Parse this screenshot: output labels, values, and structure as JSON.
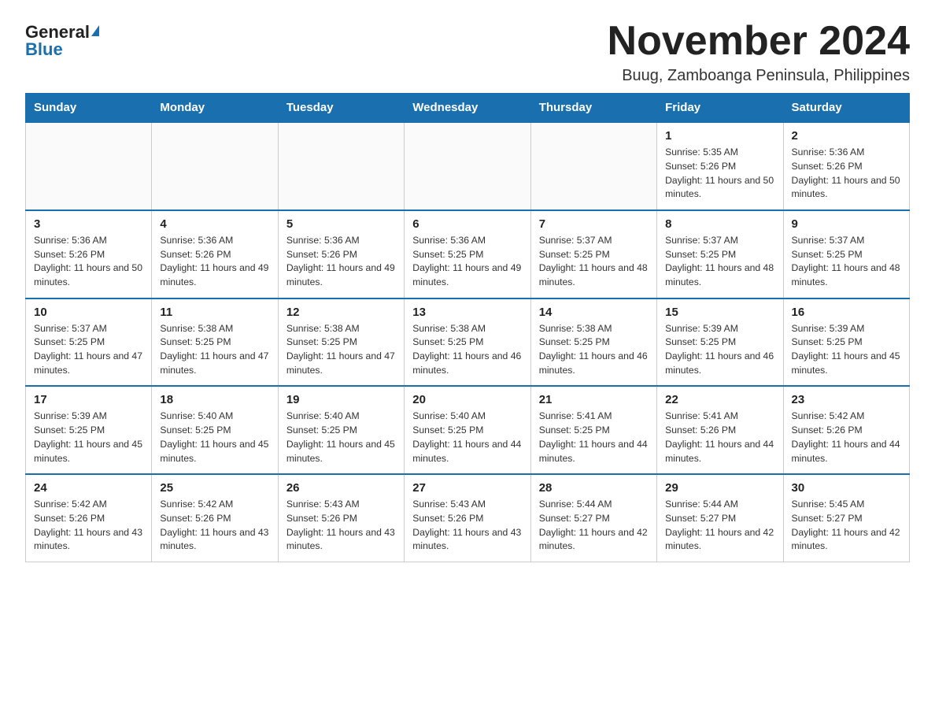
{
  "logo": {
    "general": "General",
    "blue": "Blue"
  },
  "header": {
    "month_year": "November 2024",
    "location": "Buug, Zamboanga Peninsula, Philippines"
  },
  "days_of_week": [
    "Sunday",
    "Monday",
    "Tuesday",
    "Wednesday",
    "Thursday",
    "Friday",
    "Saturday"
  ],
  "weeks": [
    [
      {
        "day": "",
        "info": ""
      },
      {
        "day": "",
        "info": ""
      },
      {
        "day": "",
        "info": ""
      },
      {
        "day": "",
        "info": ""
      },
      {
        "day": "",
        "info": ""
      },
      {
        "day": "1",
        "info": "Sunrise: 5:35 AM\nSunset: 5:26 PM\nDaylight: 11 hours and 50 minutes."
      },
      {
        "day": "2",
        "info": "Sunrise: 5:36 AM\nSunset: 5:26 PM\nDaylight: 11 hours and 50 minutes."
      }
    ],
    [
      {
        "day": "3",
        "info": "Sunrise: 5:36 AM\nSunset: 5:26 PM\nDaylight: 11 hours and 50 minutes."
      },
      {
        "day": "4",
        "info": "Sunrise: 5:36 AM\nSunset: 5:26 PM\nDaylight: 11 hours and 49 minutes."
      },
      {
        "day": "5",
        "info": "Sunrise: 5:36 AM\nSunset: 5:26 PM\nDaylight: 11 hours and 49 minutes."
      },
      {
        "day": "6",
        "info": "Sunrise: 5:36 AM\nSunset: 5:25 PM\nDaylight: 11 hours and 49 minutes."
      },
      {
        "day": "7",
        "info": "Sunrise: 5:37 AM\nSunset: 5:25 PM\nDaylight: 11 hours and 48 minutes."
      },
      {
        "day": "8",
        "info": "Sunrise: 5:37 AM\nSunset: 5:25 PM\nDaylight: 11 hours and 48 minutes."
      },
      {
        "day": "9",
        "info": "Sunrise: 5:37 AM\nSunset: 5:25 PM\nDaylight: 11 hours and 48 minutes."
      }
    ],
    [
      {
        "day": "10",
        "info": "Sunrise: 5:37 AM\nSunset: 5:25 PM\nDaylight: 11 hours and 47 minutes."
      },
      {
        "day": "11",
        "info": "Sunrise: 5:38 AM\nSunset: 5:25 PM\nDaylight: 11 hours and 47 minutes."
      },
      {
        "day": "12",
        "info": "Sunrise: 5:38 AM\nSunset: 5:25 PM\nDaylight: 11 hours and 47 minutes."
      },
      {
        "day": "13",
        "info": "Sunrise: 5:38 AM\nSunset: 5:25 PM\nDaylight: 11 hours and 46 minutes."
      },
      {
        "day": "14",
        "info": "Sunrise: 5:38 AM\nSunset: 5:25 PM\nDaylight: 11 hours and 46 minutes."
      },
      {
        "day": "15",
        "info": "Sunrise: 5:39 AM\nSunset: 5:25 PM\nDaylight: 11 hours and 46 minutes."
      },
      {
        "day": "16",
        "info": "Sunrise: 5:39 AM\nSunset: 5:25 PM\nDaylight: 11 hours and 45 minutes."
      }
    ],
    [
      {
        "day": "17",
        "info": "Sunrise: 5:39 AM\nSunset: 5:25 PM\nDaylight: 11 hours and 45 minutes."
      },
      {
        "day": "18",
        "info": "Sunrise: 5:40 AM\nSunset: 5:25 PM\nDaylight: 11 hours and 45 minutes."
      },
      {
        "day": "19",
        "info": "Sunrise: 5:40 AM\nSunset: 5:25 PM\nDaylight: 11 hours and 45 minutes."
      },
      {
        "day": "20",
        "info": "Sunrise: 5:40 AM\nSunset: 5:25 PM\nDaylight: 11 hours and 44 minutes."
      },
      {
        "day": "21",
        "info": "Sunrise: 5:41 AM\nSunset: 5:25 PM\nDaylight: 11 hours and 44 minutes."
      },
      {
        "day": "22",
        "info": "Sunrise: 5:41 AM\nSunset: 5:26 PM\nDaylight: 11 hours and 44 minutes."
      },
      {
        "day": "23",
        "info": "Sunrise: 5:42 AM\nSunset: 5:26 PM\nDaylight: 11 hours and 44 minutes."
      }
    ],
    [
      {
        "day": "24",
        "info": "Sunrise: 5:42 AM\nSunset: 5:26 PM\nDaylight: 11 hours and 43 minutes."
      },
      {
        "day": "25",
        "info": "Sunrise: 5:42 AM\nSunset: 5:26 PM\nDaylight: 11 hours and 43 minutes."
      },
      {
        "day": "26",
        "info": "Sunrise: 5:43 AM\nSunset: 5:26 PM\nDaylight: 11 hours and 43 minutes."
      },
      {
        "day": "27",
        "info": "Sunrise: 5:43 AM\nSunset: 5:26 PM\nDaylight: 11 hours and 43 minutes."
      },
      {
        "day": "28",
        "info": "Sunrise: 5:44 AM\nSunset: 5:27 PM\nDaylight: 11 hours and 42 minutes."
      },
      {
        "day": "29",
        "info": "Sunrise: 5:44 AM\nSunset: 5:27 PM\nDaylight: 11 hours and 42 minutes."
      },
      {
        "day": "30",
        "info": "Sunrise: 5:45 AM\nSunset: 5:27 PM\nDaylight: 11 hours and 42 minutes."
      }
    ]
  ]
}
